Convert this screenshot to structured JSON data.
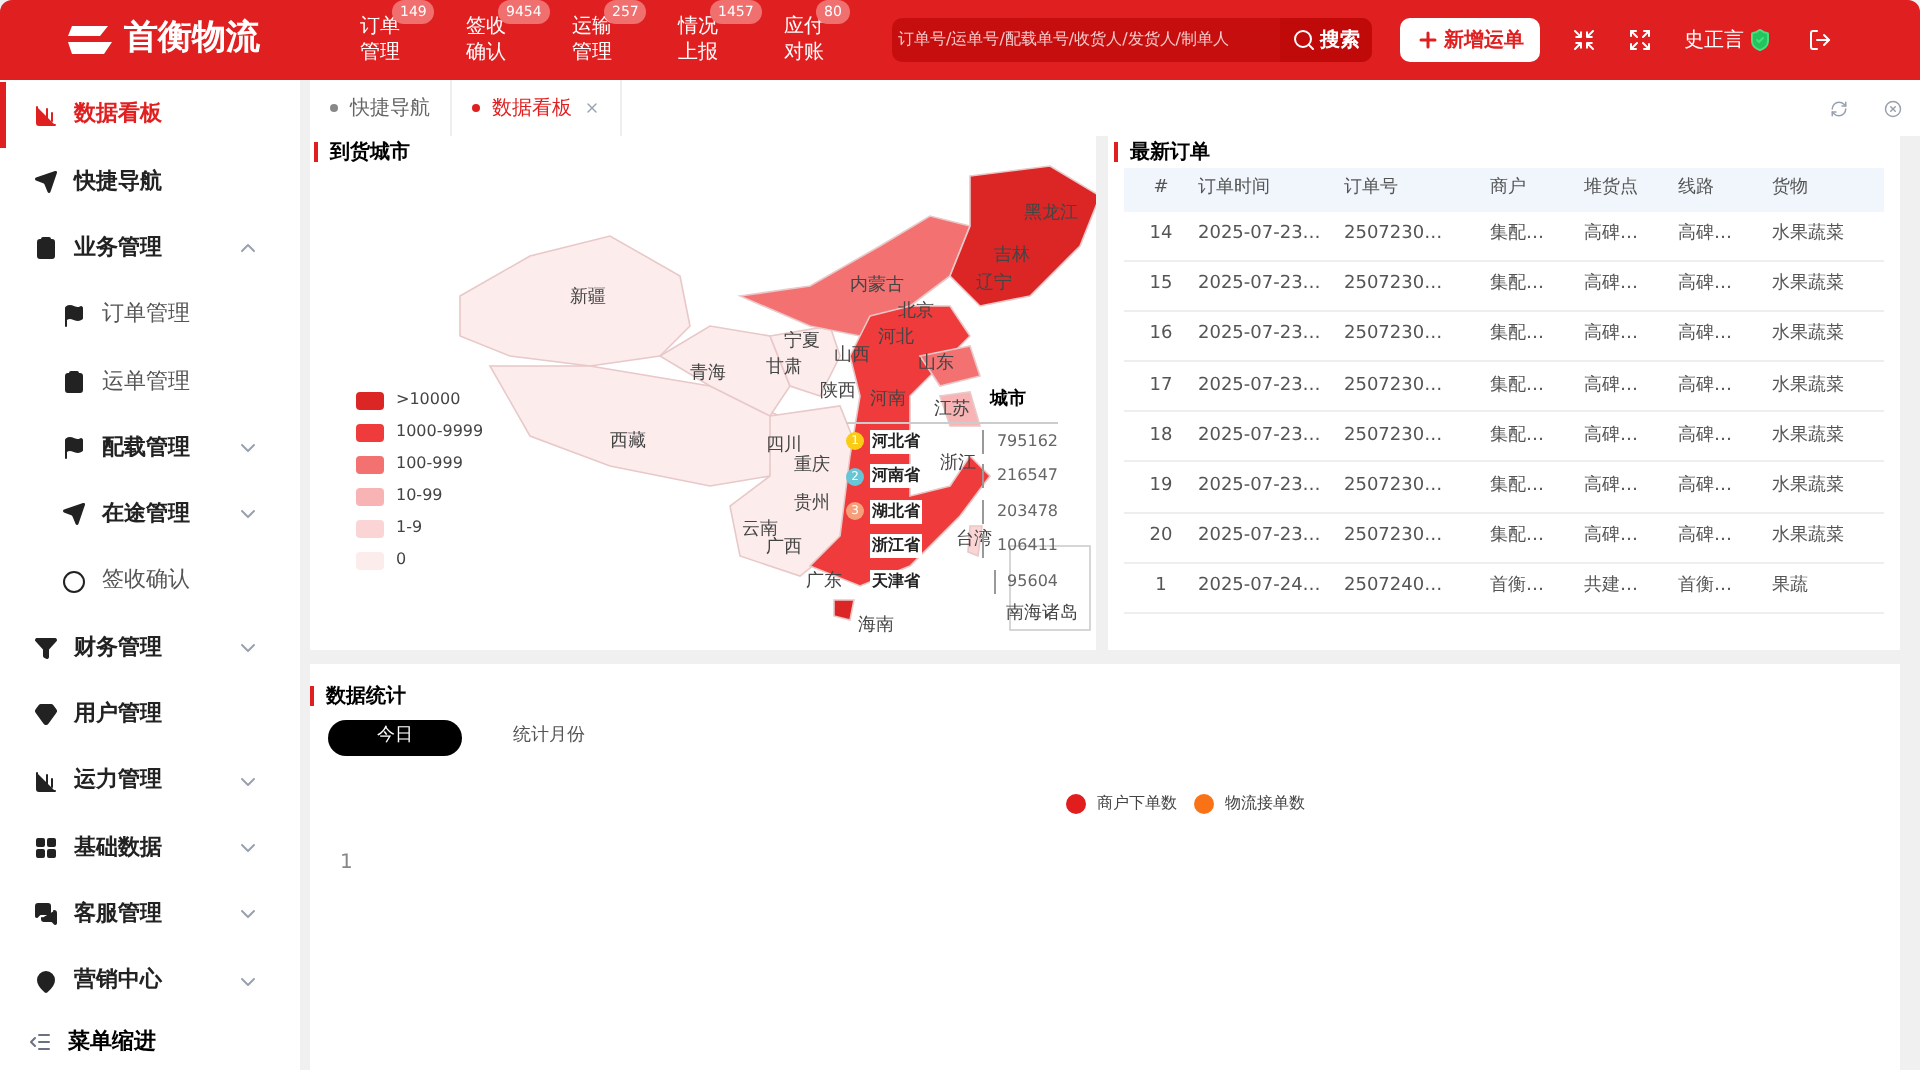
{
  "header": {
    "brand": "首衡物流",
    "nav": [
      {
        "label": "订单管理",
        "count": "149"
      },
      {
        "label": "签收确认",
        "count": "9454"
      },
      {
        "label": "运输管理",
        "count": "257"
      },
      {
        "label": "情况上报",
        "count": "1457"
      },
      {
        "label": "应付对账",
        "count": "80"
      }
    ],
    "search": {
      "placeholder": "订单号/运单号/配载单号/收货人/发货人/制单人",
      "button": "搜索"
    },
    "new_button": "新增运单",
    "user": "史正言"
  },
  "sidebar": {
    "items": [
      {
        "label": "数据看板",
        "selected": true
      },
      {
        "label": "快捷导航",
        "selected": false
      },
      {
        "label": "业务管理",
        "selected": false,
        "expanded": true,
        "children": [
          {
            "label": "订单管理",
            "selected": false
          },
          {
            "label": "运单管理",
            "selected": false
          },
          {
            "label": "配载管理",
            "selected": false,
            "expanded": false
          },
          {
            "label": "在途管理",
            "selected": false,
            "expanded": false
          },
          {
            "label": "签收确认",
            "selected": false
          }
        ]
      },
      {
        "label": "财务管理",
        "selected": false,
        "expanded": false
      },
      {
        "label": "用户管理",
        "selected": false
      },
      {
        "label": "运力管理",
        "selected": false,
        "expanded": false
      },
      {
        "label": "基础数据",
        "selected": false,
        "expanded": false
      },
      {
        "label": "客服管理",
        "selected": false,
        "expanded": false
      },
      {
        "label": "营销中心",
        "selected": false,
        "expanded": false
      }
    ],
    "footer": "菜单缩进"
  },
  "tabs": [
    {
      "label": "快捷导航",
      "selected": false
    },
    {
      "label": "数据看板",
      "selected": true
    }
  ],
  "map_panel": {
    "title": "到货城市",
    "legend": [
      {
        "label": ">10000",
        "color": "#dc2626"
      },
      {
        "label": "1000-9999",
        "color": "#ef3b3b"
      },
      {
        "label": "100-999",
        "color": "#f47171"
      },
      {
        "label": "10-99",
        "color": "#f8b4b4"
      },
      {
        "label": "1-9",
        "color": "#fbd5d5"
      },
      {
        "label": "0",
        "color": "#fdecec"
      }
    ],
    "regions": [
      "新疆",
      "西藏",
      "青海",
      "甘肃",
      "宁夏",
      "内蒙古",
      "黑龙江",
      "吉林",
      "辽宁",
      "北京",
      "河北",
      "山西",
      "山东",
      "陕西",
      "河南",
      "江苏",
      "四川",
      "重庆",
      "贵州",
      "浙江",
      "云南",
      "广西",
      "广东",
      "台湾",
      "海南",
      "南海诸岛"
    ],
    "ranking": {
      "header": "城市",
      "rows": [
        {
          "rank": "1",
          "name": "河北省",
          "value": "795162",
          "color": "#facc15"
        },
        {
          "rank": "2",
          "name": "河南省",
          "value": "216547",
          "color": "#67c5d6"
        },
        {
          "rank": "3",
          "name": "湖北省",
          "value": "203478",
          "color": "#f5a07a"
        },
        {
          "name": "浙江省",
          "value": "106411"
        },
        {
          "name": "天津省",
          "value": "95604"
        }
      ]
    }
  },
  "orders_panel": {
    "title": "最新订单",
    "columns": [
      "#",
      "订单时间",
      "订单号",
      "商户",
      "堆货点",
      "线路",
      "货物"
    ],
    "rows": [
      [
        "14",
        "2025-07-23…",
        "2507230…",
        "集配…",
        "高碑…",
        "高碑…",
        "水果蔬菜"
      ],
      [
        "15",
        "2025-07-23…",
        "2507230…",
        "集配…",
        "高碑…",
        "高碑…",
        "水果蔬菜"
      ],
      [
        "16",
        "2025-07-23…",
        "2507230…",
        "集配…",
        "高碑…",
        "高碑…",
        "水果蔬菜"
      ],
      [
        "17",
        "2025-07-23…",
        "2507230…",
        "集配…",
        "高碑…",
        "高碑…",
        "水果蔬菜"
      ],
      [
        "18",
        "2025-07-23…",
        "2507230…",
        "集配…",
        "高碑…",
        "高碑…",
        "水果蔬菜"
      ],
      [
        "19",
        "2025-07-23…",
        "2507230…",
        "集配…",
        "高碑…",
        "高碑…",
        "水果蔬菜"
      ],
      [
        "20",
        "2025-07-23…",
        "2507230…",
        "集配…",
        "高碑…",
        "高碑…",
        "水果蔬菜"
      ],
      [
        "1",
        "2025-07-24…",
        "2507240…",
        "首衡…",
        "共建…",
        "首衡…",
        "果蔬"
      ]
    ]
  },
  "stats_panel": {
    "title": "数据统计",
    "segments": [
      {
        "label": "今日",
        "selected": true
      },
      {
        "label": "统计月份",
        "selected": false
      }
    ],
    "legend": [
      {
        "label": "商户下单数",
        "color": "#e11d1d"
      },
      {
        "label": "物流接单数",
        "color": "#f97316"
      }
    ],
    "axis_label": "1"
  }
}
